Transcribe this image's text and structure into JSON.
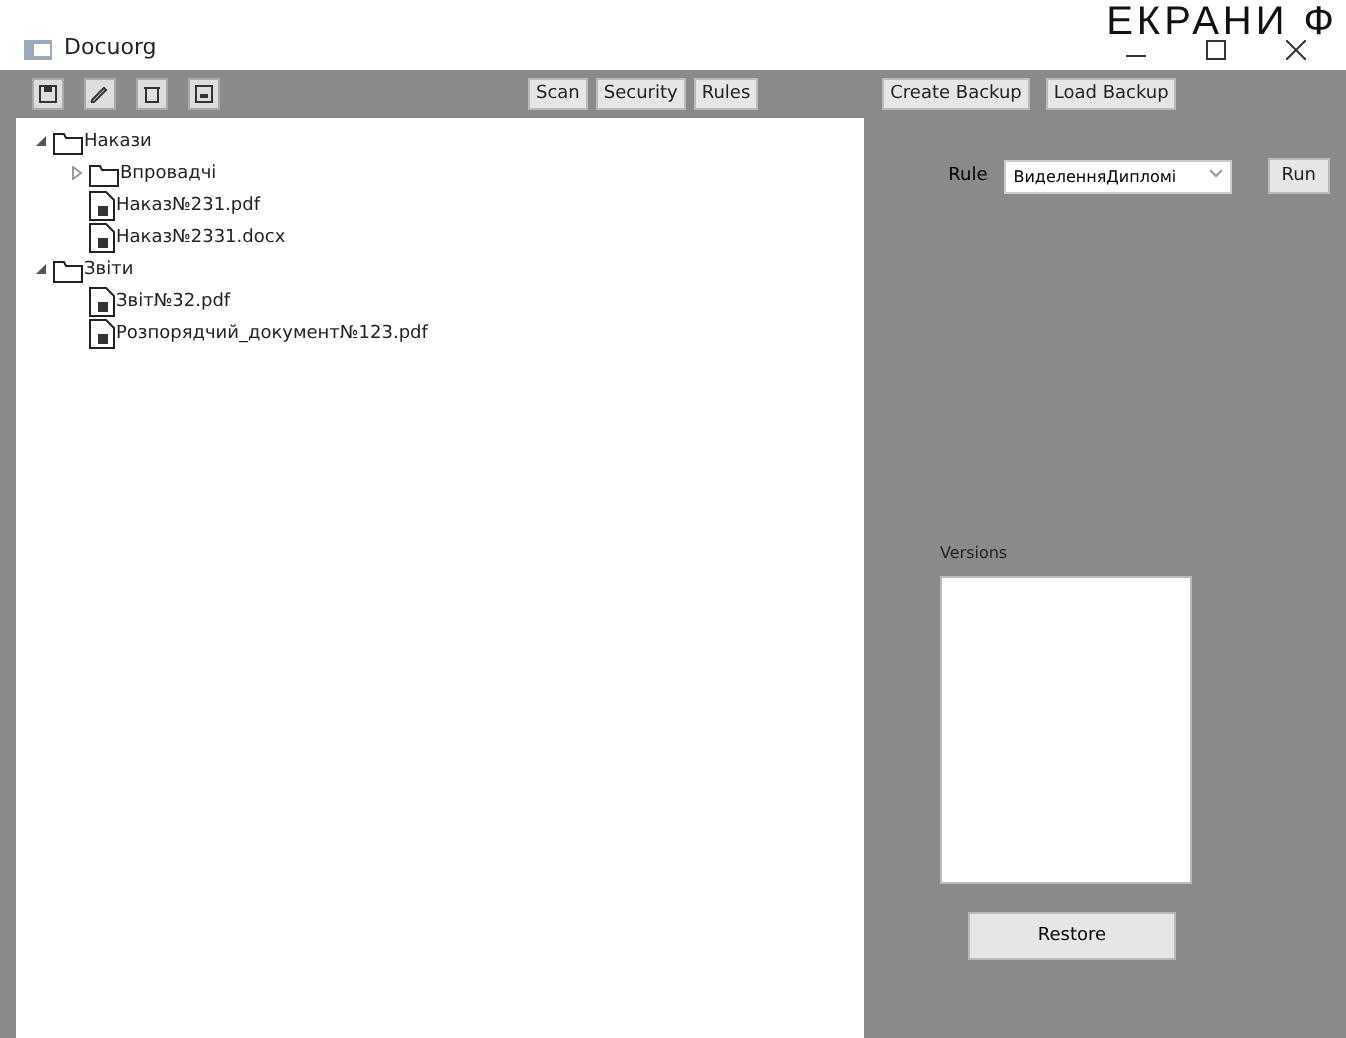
{
  "caption": "ЕКРАНИ Ф",
  "window": {
    "title": "Docuorg"
  },
  "toolbar": {
    "buttons": [
      "Scan",
      "Security",
      "Rules"
    ],
    "backup_buttons": [
      "Create Backup",
      "Load Backup"
    ]
  },
  "tree": [
    {
      "label": "Накази",
      "kind": "folder",
      "expanded": true,
      "children": [
        {
          "label": "Впровадчі",
          "kind": "folder",
          "expanded": false
        },
        {
          "label": "Наказ№231.pdf",
          "kind": "file"
        },
        {
          "label": "Наказ№2331.docx",
          "kind": "file"
        }
      ]
    },
    {
      "label": "Звіти",
      "kind": "folder",
      "expanded": true,
      "children": [
        {
          "label": "Звіт№32.pdf",
          "kind": "file"
        },
        {
          "label": "Розпорядчий_документ№123.pdf",
          "kind": "file"
        }
      ]
    }
  ],
  "rule": {
    "label": "Rule",
    "value": "ВиделенняДипломі",
    "run": "Run"
  },
  "versions": {
    "label": "Versions"
  },
  "restore": "Restore"
}
